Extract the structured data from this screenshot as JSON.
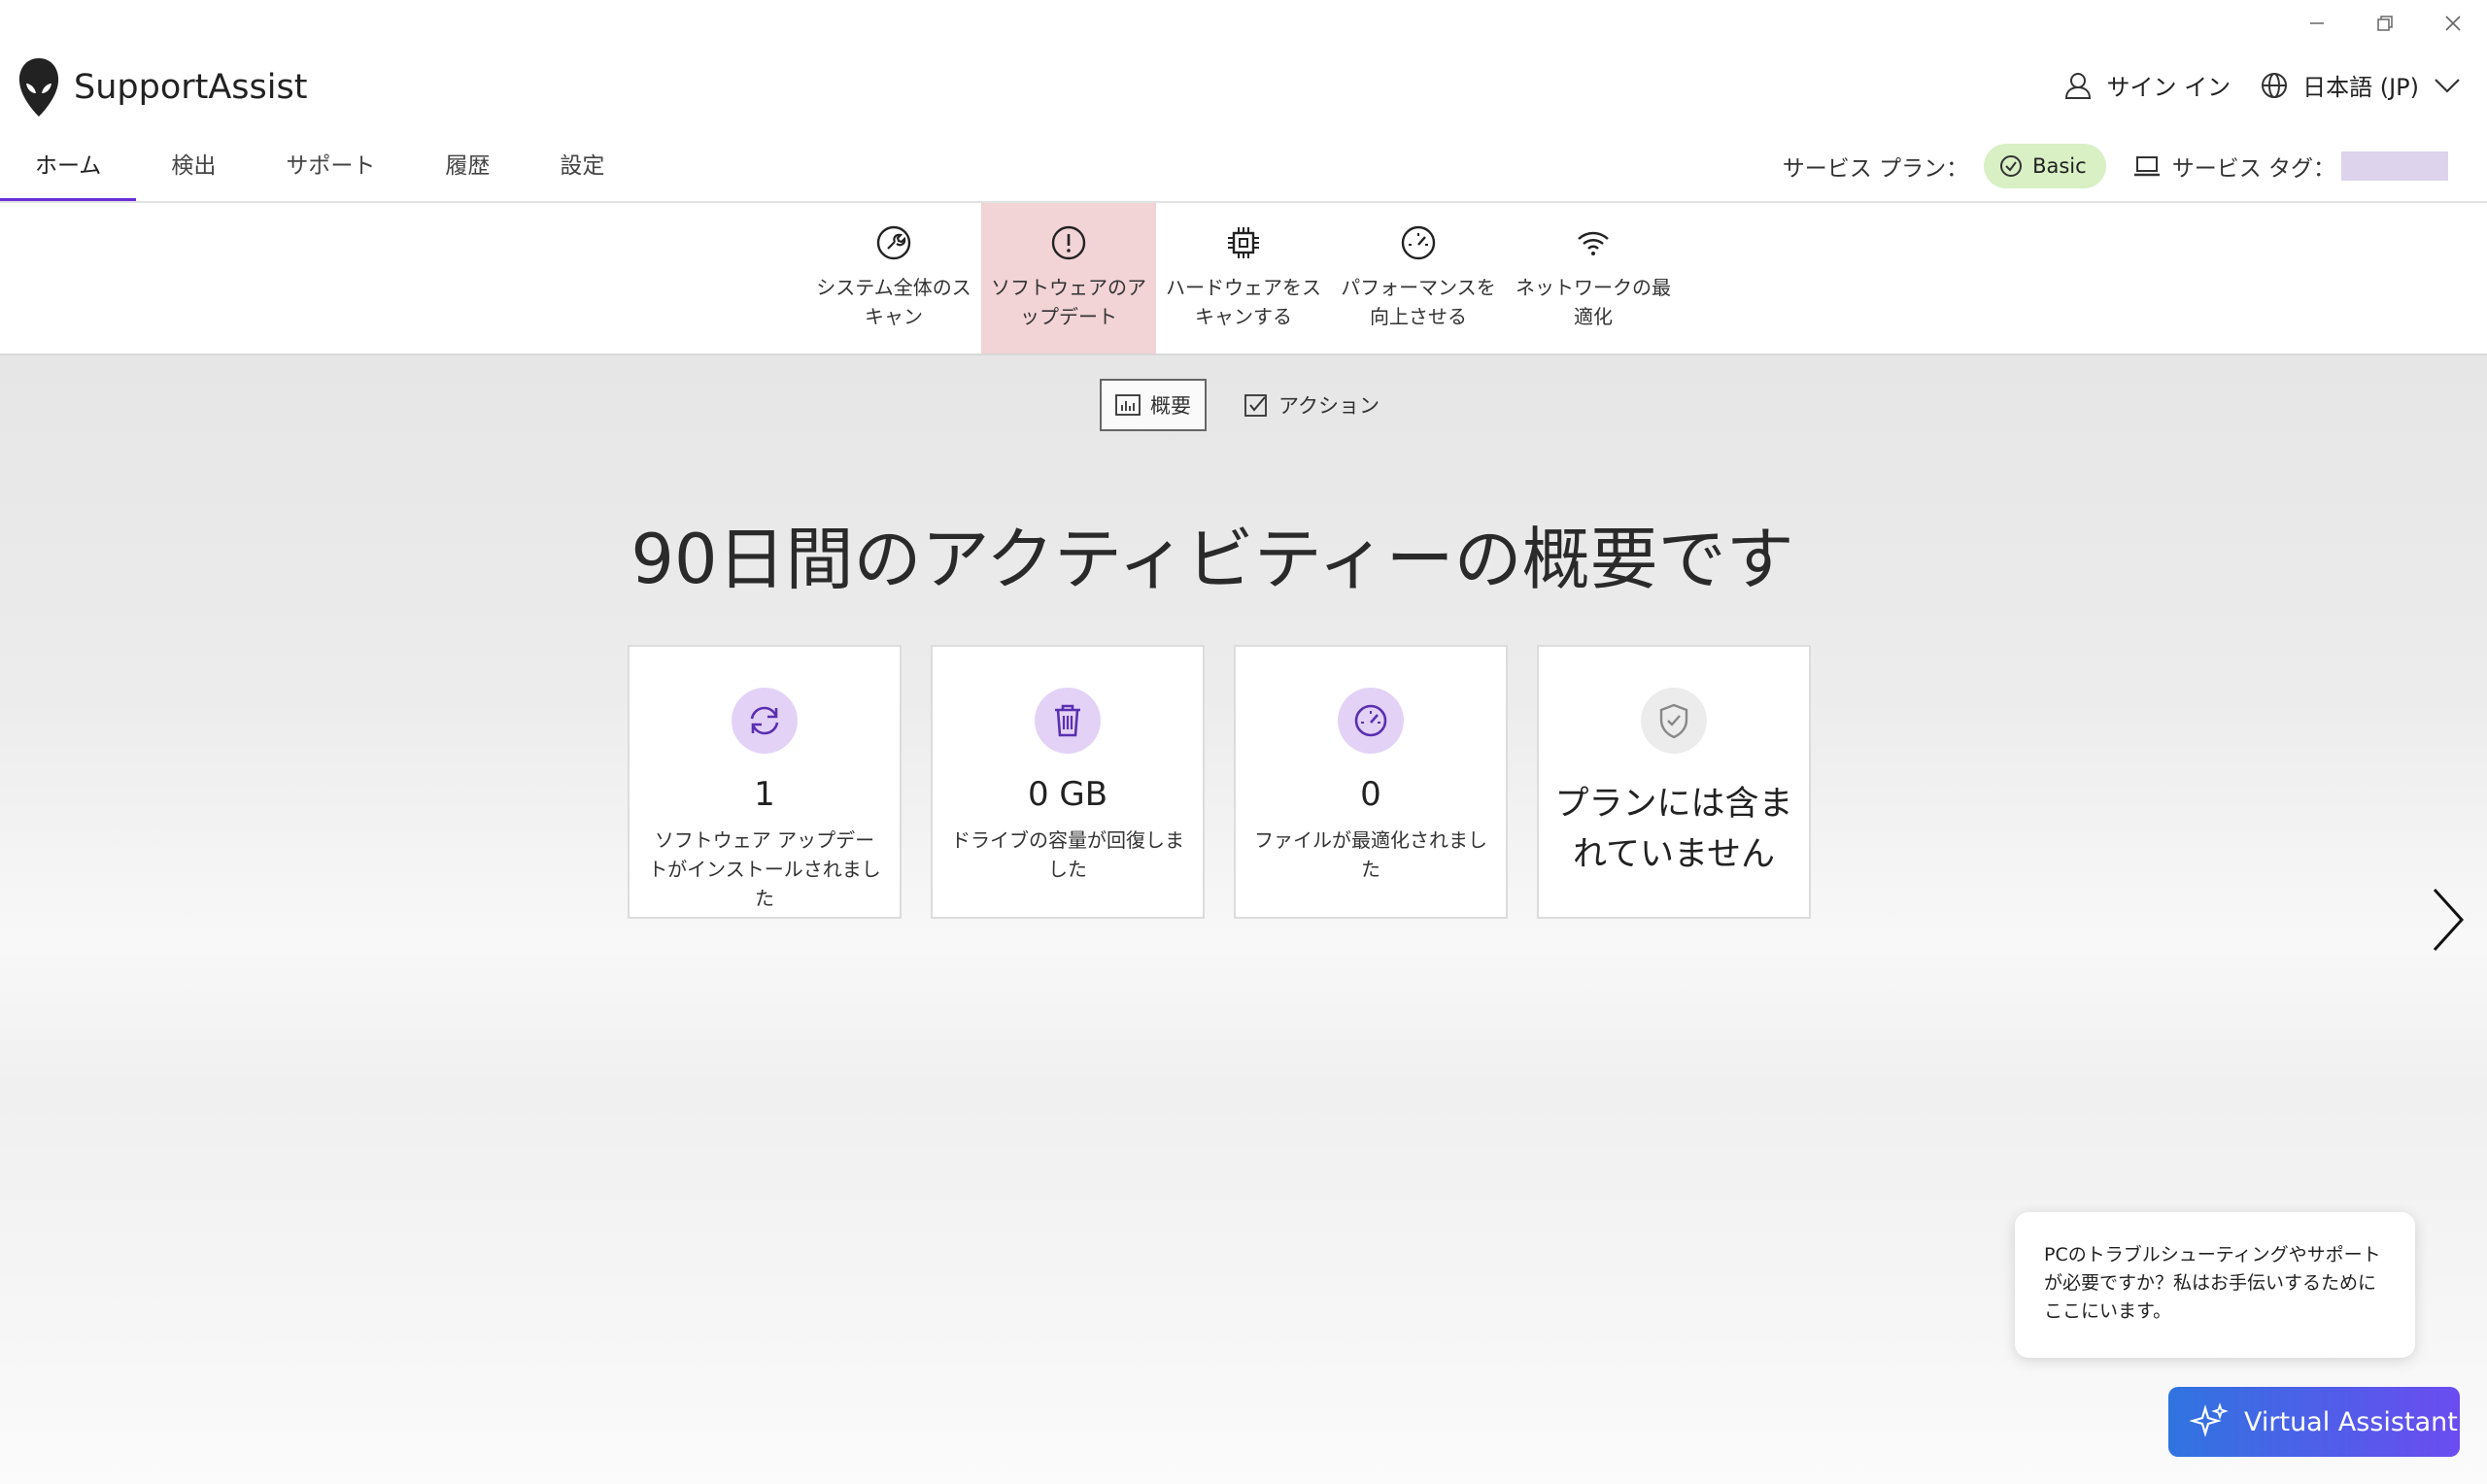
{
  "window": {
    "minimize_icon": "minimize-icon",
    "restore_icon": "restore-icon",
    "close_icon": "close-icon"
  },
  "app": {
    "title": "SupportAssist",
    "logo_icon": "alien-head-icon"
  },
  "header": {
    "sign_in": "サイン イン",
    "language": "日本語 (JP)"
  },
  "nav": {
    "tabs": [
      {
        "label": "ホーム",
        "active": true
      },
      {
        "label": "検出"
      },
      {
        "label": "サポート"
      },
      {
        "label": "履歴"
      },
      {
        "label": "設定"
      }
    ]
  },
  "service": {
    "plan_label": "サービス プラン：",
    "plan_value": "Basic",
    "tag_label": "サービス タグ：",
    "tag_value": ""
  },
  "tools": [
    {
      "label": "システム全体のスキャン",
      "icon": "wrench-scan-icon"
    },
    {
      "label": "ソフトウェアのアップデート",
      "icon": "alert-circle-icon",
      "active": true
    },
    {
      "label": "ハードウェアをスキャンする",
      "icon": "chip-icon"
    },
    {
      "label": "パフォーマンスを向上させる",
      "icon": "speedometer-icon"
    },
    {
      "label": "ネットワークの最適化",
      "icon": "wifi-icon"
    }
  ],
  "subtabs": {
    "overview": "概要",
    "actions": "アクション"
  },
  "headline": "90日間のアクティビティーの概要です",
  "cards": [
    {
      "value": "1",
      "desc": "ソフトウェア アップデートがインストールされました",
      "icon": "refresh-icon"
    },
    {
      "value": "0 GB",
      "desc": "ドライブの容量が回復しました",
      "icon": "trash-icon"
    },
    {
      "value": "0",
      "desc": "ファイルが最適化されました",
      "icon": "speedometer-icon"
    },
    {
      "big": "プランには含まれていません",
      "icon": "shield-check-icon"
    }
  ],
  "assistant": {
    "bubble": "PCのトラブルシューティングやサポートが必要ですか？私はお手伝いするためにここにいます。",
    "button": "Virtual Assistant"
  },
  "colors": {
    "accent": "#6b2fd6",
    "active_tool": "#f2d3d6",
    "plan_badge": "#d8f0c4",
    "icon_circle": "#e3d2f6"
  }
}
